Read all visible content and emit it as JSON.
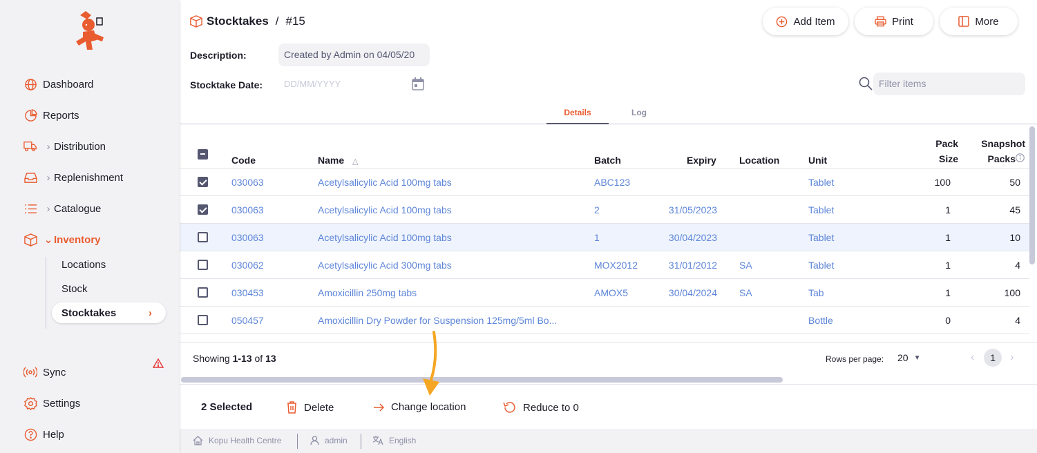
{
  "app": {
    "brand_color": "#e95c30",
    "text_color": "#1c1c28",
    "link_color": "#5e86d9"
  },
  "sidebar": {
    "items": [
      {
        "label": "Dashboard",
        "icon": "globe-icon"
      },
      {
        "label": "Reports",
        "icon": "pie-chart-icon"
      },
      {
        "label": "Distribution",
        "icon": "truck-icon"
      },
      {
        "label": "Replenishment",
        "icon": "inbox-icon"
      },
      {
        "label": "Catalogue",
        "icon": "list-icon"
      },
      {
        "label": "Inventory",
        "icon": "box-icon"
      }
    ],
    "sub_items": [
      {
        "label": "Locations"
      },
      {
        "label": "Stock"
      },
      {
        "label": "Stocktakes"
      }
    ],
    "bottom_items": [
      {
        "label": "Sync",
        "icon": "radio-icon"
      },
      {
        "label": "Settings",
        "icon": "gear-icon"
      },
      {
        "label": "Help",
        "icon": "help-icon"
      }
    ]
  },
  "header": {
    "breadcrumb_root": "Stocktakes",
    "separator": "/",
    "breadcrumb_current": "#15",
    "buttons": {
      "add_item": "Add Item",
      "print": "Print",
      "more": "More"
    }
  },
  "form": {
    "description_label": "Description:",
    "description_value": "Created by Admin on 04/05/20",
    "date_label": "Stocktake Date:",
    "date_placeholder": "DD/MM/YYYY",
    "filter_placeholder": "Filter items"
  },
  "tabs": [
    {
      "label": "Details"
    },
    {
      "label": "Log"
    }
  ],
  "table": {
    "headers": {
      "code": "Code",
      "name": "Name",
      "batch": "Batch",
      "expiry": "Expiry",
      "location": "Location",
      "unit": "Unit",
      "pack_size_1": "Pack",
      "pack_size_2": "Size",
      "snapshot_1": "Snapshot",
      "snapshot_2": "Packs"
    },
    "rows": [
      {
        "code": "030063",
        "name": "Acetylsalicylic Acid 100mg tabs",
        "batch": "ABC123",
        "expiry": "",
        "location": "",
        "unit": "Tablet",
        "pack_size": "100",
        "snapshot": "50"
      },
      {
        "code": "030063",
        "name": "Acetylsalicylic Acid 100mg tabs",
        "batch": "2",
        "expiry": "31/05/2023",
        "location": "",
        "unit": "Tablet",
        "pack_size": "1",
        "snapshot": "45"
      },
      {
        "code": "030063",
        "name": "Acetylsalicylic Acid 100mg tabs",
        "batch": "1",
        "expiry": "30/04/2023",
        "location": "",
        "unit": "Tablet",
        "pack_size": "1",
        "snapshot": "10"
      },
      {
        "code": "030062",
        "name": "Acetylsalicylic Acid 300mg tabs",
        "batch": "MOX2012",
        "expiry": "31/01/2012",
        "location": "SA",
        "unit": "Tablet",
        "pack_size": "1",
        "snapshot": "4"
      },
      {
        "code": "030453",
        "name": "Amoxicillin 250mg tabs",
        "batch": "AMOX5",
        "expiry": "30/04/2024",
        "location": "SA",
        "unit": "Tab",
        "pack_size": "1",
        "snapshot": "100"
      },
      {
        "code": "050457",
        "name": "Amoxicillin Dry Powder for Suspension 125mg/5ml Bo...",
        "batch": "",
        "expiry": "",
        "location": "",
        "unit": "Bottle",
        "pack_size": "0",
        "snapshot": "4"
      }
    ],
    "row_checked": [
      true,
      true,
      false,
      false,
      false,
      false
    ]
  },
  "pagination": {
    "showing_prefix": "Showing ",
    "range": "1-13",
    "of": " of ",
    "total": "13",
    "rows_per_page_label": "Rows per page:",
    "rows_per_page": "20",
    "current_page": "1"
  },
  "actions": {
    "selected": "2 Selected",
    "delete": "Delete",
    "change_location": "Change location",
    "reduce": "Reduce to 0"
  },
  "status": {
    "store": "Kopu Health Centre",
    "user": "admin",
    "language": "English"
  }
}
